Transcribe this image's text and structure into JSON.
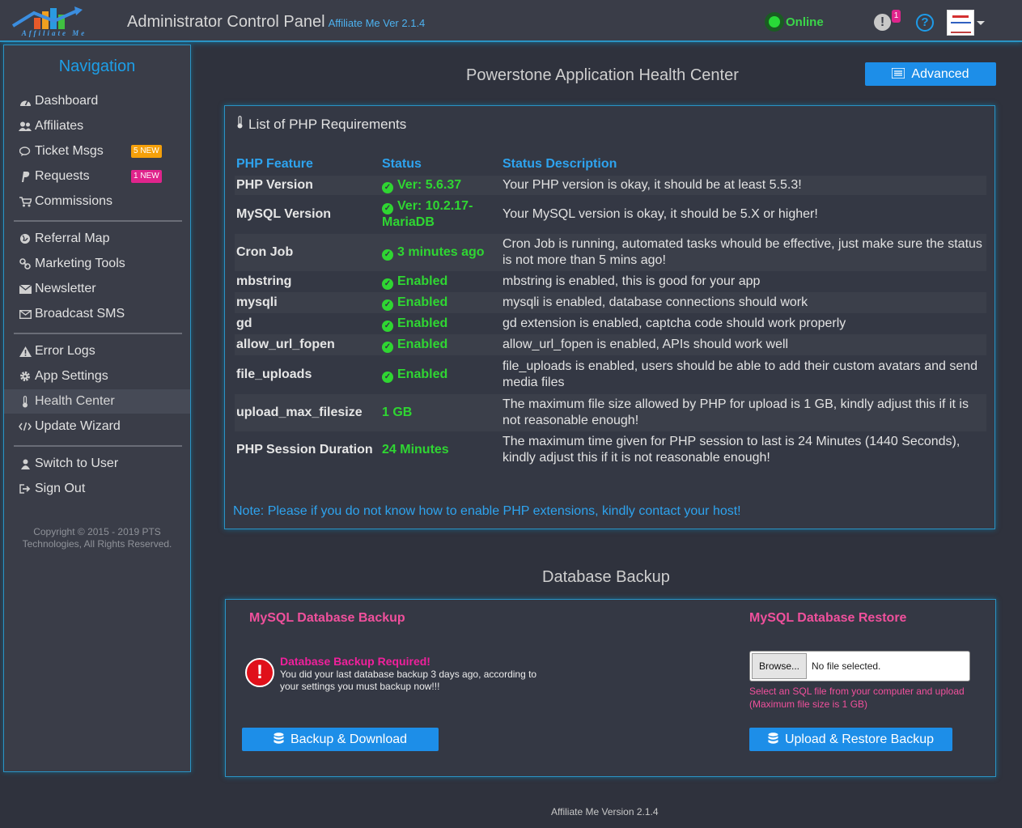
{
  "header": {
    "logo_text": "Affiliate Me",
    "title": "Administrator Control Panel",
    "version": "Affiliate Me Ver 2.1.4",
    "status": "Online",
    "alert_count": "1"
  },
  "sidebar": {
    "title": "Navigation",
    "items": [
      {
        "label": "Dashboard",
        "icon": "dashboard-icon"
      },
      {
        "label": "Affiliates",
        "icon": "users-icon"
      },
      {
        "label": "Ticket Msgs",
        "icon": "comments-icon",
        "badge": "5 NEW"
      },
      {
        "label": "Requests",
        "icon": "paypal-icon",
        "badge": "1 NEW"
      },
      {
        "label": "Commissions",
        "icon": "cart-icon"
      },
      {
        "label": "Referral Map",
        "icon": "globe-icon"
      },
      {
        "label": "Marketing Tools",
        "icon": "link-icon"
      },
      {
        "label": "Newsletter",
        "icon": "envelope-icon"
      },
      {
        "label": "Broadcast SMS",
        "icon": "envelope-outline-icon"
      },
      {
        "label": "Error Logs",
        "icon": "warning-icon"
      },
      {
        "label": "App Settings",
        "icon": "cog-icon"
      },
      {
        "label": "Health Center",
        "icon": "thermometer-icon"
      },
      {
        "label": "Update Wizard",
        "icon": "code-icon"
      },
      {
        "label": "Switch to User",
        "icon": "user-icon"
      },
      {
        "label": "Sign Out",
        "icon": "sign-out-icon"
      }
    ],
    "copyright": "Copyright © 2015 - 2019 PTS Technologies, All Rights Reserved."
  },
  "health": {
    "title": "Powerstone Application Health Center",
    "advanced_label": "Advanced",
    "panel_title": "List of PHP Requirements",
    "columns": [
      "PHP Feature",
      "Status",
      "Status Description"
    ],
    "rows": [
      {
        "feature": "PHP Version",
        "status": "Ver: 5.6.37",
        "check": true,
        "desc": "Your PHP version is okay, it should be at least 5.5.3!"
      },
      {
        "feature": "MySQL Version",
        "status": "Ver: 10.2.17-MariaDB",
        "check": true,
        "desc": "Your MySQL version is okay, it should be 5.X or higher!"
      },
      {
        "feature": "Cron Job",
        "status": "3 minutes ago",
        "check": true,
        "desc": "Cron Job is running, automated tasks whould be effective, just make sure the status is not more than 5 mins ago!"
      },
      {
        "feature": "mbstring",
        "status": "Enabled",
        "check": true,
        "desc": "mbstring is enabled, this is good for your app"
      },
      {
        "feature": "mysqli",
        "status": "Enabled",
        "check": true,
        "desc": "mysqli is enabled, database connections should work"
      },
      {
        "feature": "gd",
        "status": "Enabled",
        "check": true,
        "desc": "gd extension is enabled, captcha code should work properly"
      },
      {
        "feature": "allow_url_fopen",
        "status": "Enabled",
        "check": true,
        "desc": "allow_url_fopen is enabled, APIs should work well"
      },
      {
        "feature": "file_uploads",
        "status": "Enabled",
        "check": true,
        "desc": "file_uploads is enabled, users should be able to add their custom avatars and send media files"
      },
      {
        "feature": "upload_max_filesize",
        "status": "1 GB",
        "check": false,
        "desc": "The maximum file size allowed by PHP for upload is 1 GB, kindly adjust this if it is not reasonable enough!"
      },
      {
        "feature": "PHP Session Duration",
        "status": "24 Minutes",
        "check": false,
        "desc": "The maximum time given for PHP session to last is 24 Minutes (1440 Seconds), kindly adjust this if it is not reasonable enough!"
      }
    ],
    "note": "Note: Please if you do not know how to enable PHP extensions, kindly contact your host!"
  },
  "backup": {
    "title": "Database Backup",
    "backup_head": "MySQL Database Backup",
    "restore_head": "MySQL Database Restore",
    "warn_title": "Database Backup Required!",
    "warn_text": "You did your last database backup 3 days ago, according to your settings you must backup now!!!",
    "backup_button": "Backup & Download",
    "browse_label": "Browse...",
    "file_status": "No file selected.",
    "restore_hint": "Select an SQL file from your computer and upload (Maximum file size is 1 GB)",
    "restore_button": "Upload & Restore Backup"
  },
  "footer": "Affiliate Me Version 2.1.4",
  "colors": {
    "accent": "#1d8ee8",
    "success": "#2fd632",
    "danger": "#e0101a",
    "pink": "#f0509c",
    "badge_orange": "#f5a00a",
    "badge_pink": "#e0248c"
  }
}
